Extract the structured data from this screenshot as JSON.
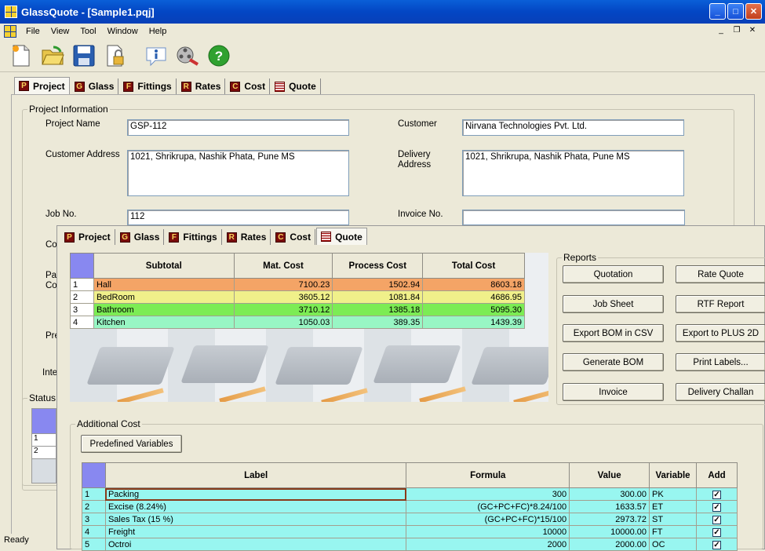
{
  "window": {
    "title": "GlassQuote - [Sample1.pqj]",
    "minimize": "_",
    "maximize": "□",
    "close": "✕"
  },
  "menu": [
    "File",
    "View",
    "Tool",
    "Window",
    "Help"
  ],
  "mdi_controls": {
    "minimize": "_",
    "restore": "❐",
    "close": "✕"
  },
  "toolbar": [
    "new-document-icon",
    "open-folder-icon",
    "save-disk-icon",
    "lock-file-icon",
    "info-icon",
    "film-reel-icon",
    "help-icon"
  ],
  "tabs": [
    {
      "letter": "P",
      "label": "Project"
    },
    {
      "letter": "G",
      "label": "Glass"
    },
    {
      "letter": "F",
      "label": "Fittings"
    },
    {
      "letter": "R",
      "label": "Rates"
    },
    {
      "letter": "C",
      "label": "Cost"
    },
    {
      "letter": "",
      "label": "Quote"
    }
  ],
  "project": {
    "group_title": "Project Information",
    "project_name_label": "Project Name",
    "project_name": "GSP-112",
    "customer_label": "Customer",
    "customer": "Nirvana Technologies Pvt. Ltd.",
    "customer_address_label": "Customer Address",
    "customer_address": "1021, Shrikrupa, Nashik Phata, Pune MS",
    "delivery_address_label_1": "Delivery",
    "delivery_address_label_2": "Address",
    "delivery_address": "1021, Shrikrupa, Nashik Phata, Pune MS",
    "job_no_label": "Job No.",
    "job_no": "112",
    "invoice_no_label": "Invoice No.",
    "invoice_no": "",
    "partial_labels": [
      "Co",
      "Pa",
      "Co",
      "Pre",
      "Inte"
    ],
    "status_title": "Status",
    "status_rows": [
      "1",
      "2"
    ]
  },
  "quote": {
    "columns": [
      "Subtotal",
      "Mat. Cost",
      "Process Cost",
      "Total Cost"
    ],
    "rows": [
      {
        "n": "1",
        "name": "Hall",
        "mat": "7100.23",
        "proc": "1502.94",
        "total": "8603.18",
        "color": "#f4a466"
      },
      {
        "n": "2",
        "name": "BedRoom",
        "mat": "3605.12",
        "proc": "1081.84",
        "total": "4686.95",
        "color": "#f0f08a"
      },
      {
        "n": "3",
        "name": "Bathroom",
        "mat": "3710.12",
        "proc": "1385.18",
        "total": "5095.30",
        "color": "#7cec54"
      },
      {
        "n": "4",
        "name": "Kitchen",
        "mat": "1050.03",
        "proc": "389.35",
        "total": "1439.39",
        "color": "#98f6c4"
      }
    ]
  },
  "reports": {
    "title": "Reports",
    "buttons": [
      "Quotation",
      "Rate Quote",
      "Job Sheet",
      "RTF Report",
      "Export BOM in CSV",
      "Export to PLUS 2D",
      "Generate BOM",
      "Print Labels...",
      "Invoice",
      "Delivery Challan"
    ]
  },
  "additional_cost": {
    "title": "Additional Cost",
    "predefined_button": "Predefined Variables",
    "columns": [
      "Label",
      "Formula",
      "Value",
      "Variable",
      "Add"
    ],
    "rows": [
      {
        "n": "1",
        "label": "Packing",
        "formula": "300",
        "value": "300.00",
        "variable": "PK",
        "add": "✓"
      },
      {
        "n": "2",
        "label": "Excise (8.24%)",
        "formula": "(GC+PC+FC)*8.24/100",
        "value": "1633.57",
        "variable": "ET",
        "add": "✓"
      },
      {
        "n": "3",
        "label": "Sales Tax (15 %)",
        "formula": "(GC+PC+FC)*15/100",
        "value": "2973.72",
        "variable": "ST",
        "add": "✓"
      },
      {
        "n": "4",
        "label": "Freight",
        "formula": "10000",
        "value": "10000.00",
        "variable": "FT",
        "add": "✓"
      },
      {
        "n": "5",
        "label": "Octroi",
        "formula": "2000",
        "value": "2000.00",
        "variable": "OC",
        "add": "✓"
      }
    ]
  },
  "statusbar": {
    "text": "Ready"
  }
}
